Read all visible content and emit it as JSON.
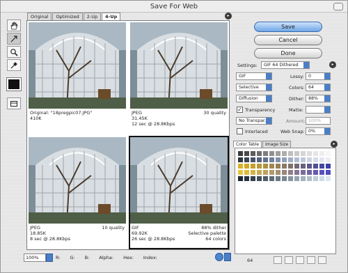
{
  "window": {
    "title": "Save For Web"
  },
  "tabs": [
    "Original",
    "Optimized",
    "2-Up",
    "4-Up"
  ],
  "active_tab": 3,
  "tools": [
    "hand-tool-icon",
    "slice-select-tool-icon",
    "zoom-tool-icon",
    "eyedropper-tool-icon"
  ],
  "eyedropper_color": "#111111",
  "panes": {
    "tl": {
      "left1": "Original: \"18pregpic07.JPG\"",
      "right1": "",
      "left2": "410K",
      "right2": "",
      "left3": "",
      "right3": ""
    },
    "tr": {
      "left1": "JPEG",
      "right1": "30 quality",
      "left2": "31.45K",
      "right2": "",
      "left3": "12 sec @ 28.8Kbps",
      "right3": ""
    },
    "bl": {
      "left1": "JPEG",
      "right1": "10 quality",
      "left2": "18.85K",
      "right2": "",
      "left3": "8 sec @ 28.8Kbps",
      "right3": ""
    },
    "br": {
      "left1": "GIF",
      "right1": "88% dither",
      "left2": "69.92K",
      "right2": "Selective palette",
      "left3": "26 sec @ 28.8Kbps",
      "right3": "64 colors"
    }
  },
  "status": {
    "zoom": "100%",
    "r": "R:",
    "g": "G:",
    "b": "B:",
    "alpha": "Alpha:",
    "hex": "Hex:",
    "index": "Index:"
  },
  "buttons": {
    "save": "Save",
    "cancel": "Cancel",
    "done": "Done"
  },
  "settings": {
    "label": "Settings:",
    "preset": "GIF 64 Dithered",
    "format": "GIF",
    "lossy_label": "Lossy:",
    "lossy": "0",
    "reduction": "Selective",
    "colors_label": "Colors:",
    "colors": "64",
    "dither_algo": "Diffusion",
    "dither_label": "Dither:",
    "dither": "88%",
    "transparency_label": "Transparency",
    "transparency_checked": true,
    "matte_label": "Matte:",
    "trans_dither": "No Transpar...",
    "amount_label": "Amount:",
    "amount": "100%",
    "interlaced_label": "Interlaced",
    "interlaced_checked": false,
    "websnap_label": "Web Snap:",
    "websnap": "0%"
  },
  "color_panel": {
    "tabs": [
      "Color Table",
      "Image Size"
    ],
    "count": "64",
    "colors": [
      "#3b3b3b",
      "#4a4a4a",
      "#5c5c5c",
      "#6c6c6c",
      "#7d7d7d",
      "#8f8f8f",
      "#9e9e9e",
      "#aeaeae",
      "#bebebe",
      "#c8c8c8",
      "#d5d5d5",
      "#dedede",
      "#e6e6e6",
      "#eeeeee",
      "#f6f6f6",
      "#2e3440",
      "#394352",
      "#465266",
      "#53617a",
      "#60708c",
      "#70809c",
      "#8090aa",
      "#90a0b8",
      "#a0aec4",
      "#b0bcd0",
      "#c0c8da",
      "#ccd4e2",
      "#d8dee8",
      "#e2e6ee",
      "#eceef4",
      "#d9b22a",
      "#cfa826",
      "#c4a030",
      "#b8973a",
      "#ad8f44",
      "#a1874e",
      "#957f58",
      "#8a7862",
      "#7e706c",
      "#726876",
      "#676080",
      "#5b588a",
      "#4f5094",
      "#43489e",
      "#3a40a6",
      "#e4c640",
      "#ddbd3a",
      "#d2b44c",
      "#c7ab56",
      "#bca260",
      "#b1996a",
      "#a69074",
      "#9b877e",
      "#907e88",
      "#857592",
      "#7a6c9c",
      "#6f63a6",
      "#645ab0",
      "#5a52b8",
      "#514ac0",
      "#1e2630",
      "#2a323e",
      "#36404c",
      "#424e5a",
      "#505c68",
      "#5e6a76",
      "#6c7884",
      "#7a8692",
      "#8894a0",
      "#96a2ae",
      "#a4b0bc",
      "#b2beca",
      "#c0ccd8",
      "#cedae4",
      "#dce6ee"
    ]
  }
}
